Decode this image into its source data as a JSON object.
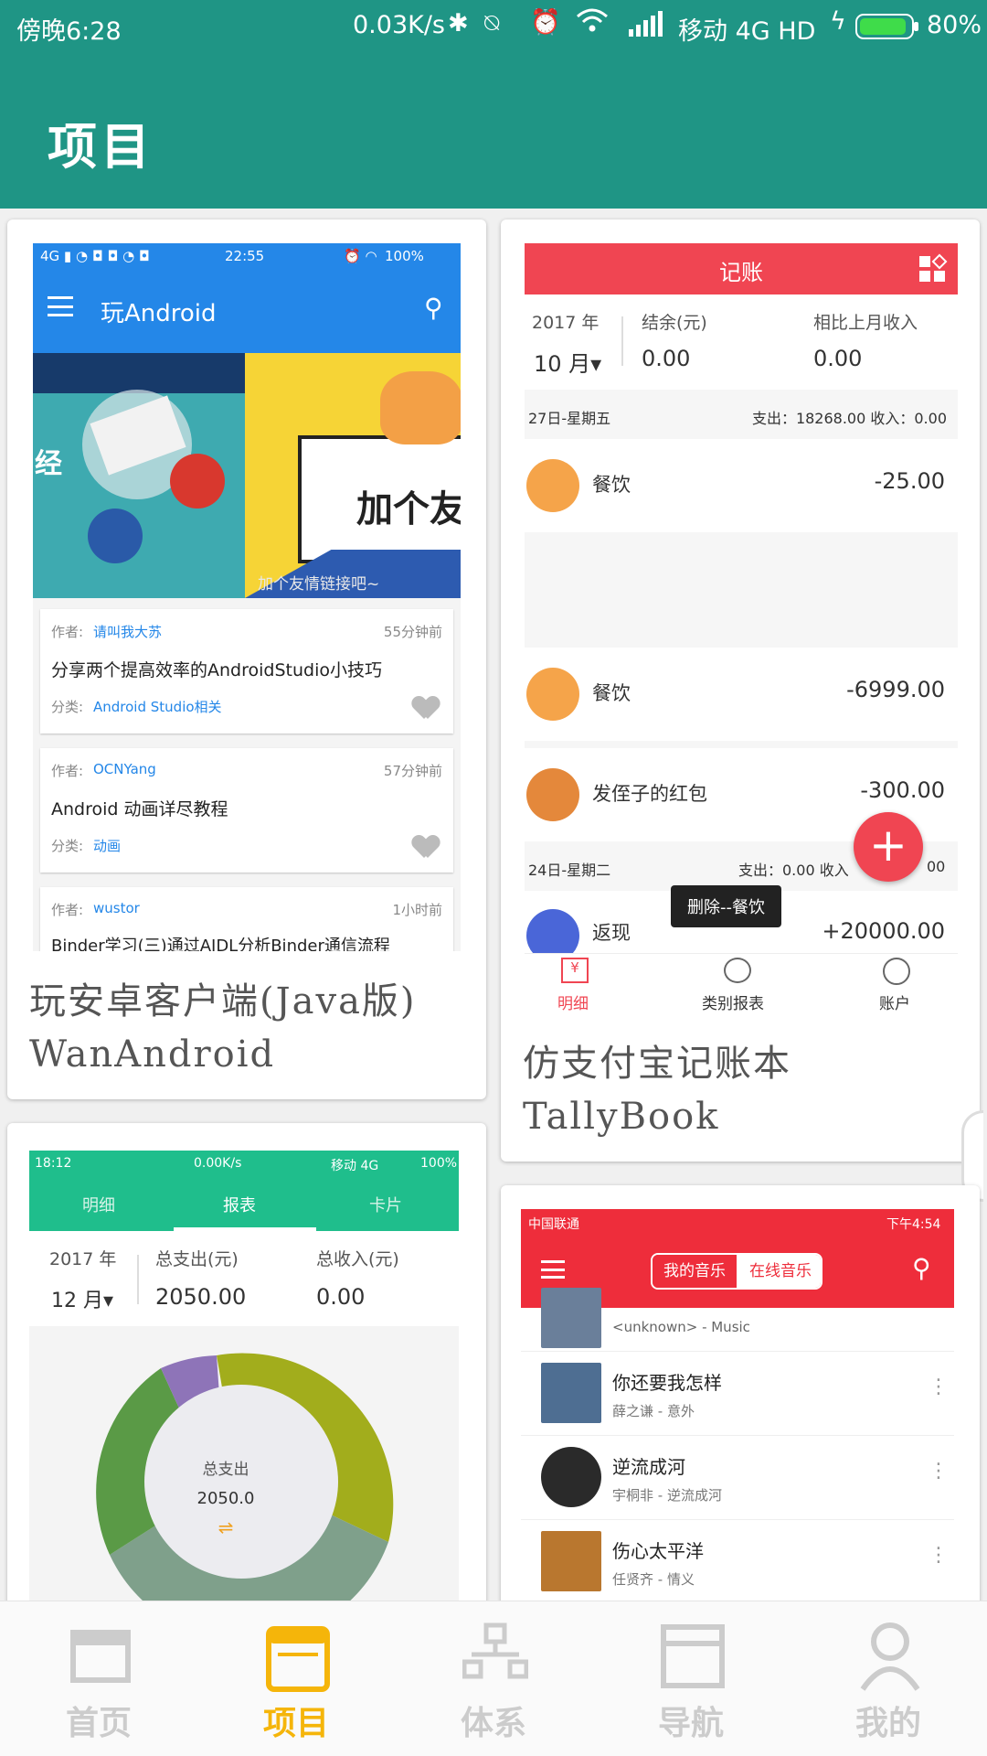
{
  "status_bar": {
    "time": "傍晚6:28",
    "net_speed": "0.03K/s",
    "carrier": "移动 4G HD",
    "battery": "80%"
  },
  "app_bar": {
    "title": "项目"
  },
  "cards": [
    {
      "caption_line1": "玩安卓客户端(Java版)",
      "caption_line2": "WanAndroid",
      "shot": {
        "status_time": "22:55",
        "status_battery": "100%",
        "title": "玩Android",
        "banner_left_text": "经",
        "banner_right_text": "加个友",
        "banner_caption": "加个友情链接吧~",
        "articles": [
          {
            "author_label": "作者:",
            "author": "请叫我大苏",
            "time": "55分钟前",
            "title": "分享两个提高效率的AndroidStudio小技巧",
            "cat_label": "分类:",
            "category": "Android Studio相关"
          },
          {
            "author_label": "作者:",
            "author": "OCNYang",
            "time": "57分钟前",
            "title": "Android 动画详尽教程",
            "cat_label": "分类:",
            "category": "动画"
          },
          {
            "author_label": "作者:",
            "author": "wustor",
            "time": "1小时前",
            "title": "Binder学习(三)通过AIDL分析Binder通信流程"
          }
        ]
      }
    },
    {
      "caption_line1": "仿支付宝记账本",
      "caption_line2": "TallyBook",
      "shot": {
        "title": "记账",
        "year": "2017 年",
        "month": "10 月▾",
        "balance_label": "结余(元)",
        "balance": "0.00",
        "income_label": "相比上月收入",
        "income": "0.00",
        "day1_label": "27日-星期五",
        "day1_summary": "支出：18268.00 收入：0.00",
        "entries": [
          {
            "name": "餐饮",
            "amount": "-25.00",
            "color": "#f5a44a"
          },
          {
            "name": "餐饮",
            "amount": "-6999.00",
            "color": "#f5a44a"
          },
          {
            "name": "发侄子的红包",
            "amount": "-300.00",
            "color": "#e4883b"
          }
        ],
        "day2_label": "24日-星期二",
        "day2_summary": "支出：0.00 收入",
        "day2_tail": "00",
        "toast": "删除--餐饮",
        "partial_row": "返现",
        "partial_amount": "+20000.00",
        "tabs": [
          "明细",
          "类别报表",
          "账户"
        ]
      }
    },
    {
      "shot": {
        "status_time": "18:12",
        "status_speed": "0.00K/s",
        "status_carrier": "移动 4G",
        "status_battery": "100%",
        "tabs": [
          "明细",
          "报表",
          "卡片"
        ],
        "year": "2017 年",
        "month": "12 月▾",
        "expense_label": "总支出(元)",
        "expense": "2050.00",
        "income_label": "总收入(元)",
        "income": "0.00",
        "donut_label": "总支出",
        "donut_value": "2050.0",
        "donut_icon": "⇌"
      }
    },
    {
      "shot": {
        "status_carrier": "中国联通",
        "status_time": "下午4:54",
        "tab_mine": "我的音乐",
        "tab_online": "在线音乐",
        "first_sub": "<unknown> - Music",
        "songs": [
          {
            "title": "你还要我怎样",
            "sub": "薛之谦 - 意外"
          },
          {
            "title": "逆流成河",
            "sub": "宇桐非 - 逆流成河"
          },
          {
            "title": "伤心太平洋",
            "sub": "任贤齐 - 情义"
          }
        ]
      }
    }
  ],
  "bottom_nav": [
    {
      "label": "首页",
      "active": false
    },
    {
      "label": "项目",
      "active": true
    },
    {
      "label": "体系",
      "active": false
    },
    {
      "label": "导航",
      "active": false
    },
    {
      "label": "我的",
      "active": false
    }
  ],
  "colors": {
    "primary": "#1f9585",
    "accent_yellow": "#f5b50a",
    "tally_red": "#f04552",
    "wan_blue": "#2487e8",
    "chart_green": "#1fbe8c",
    "music_red": "#ee2d3b"
  }
}
